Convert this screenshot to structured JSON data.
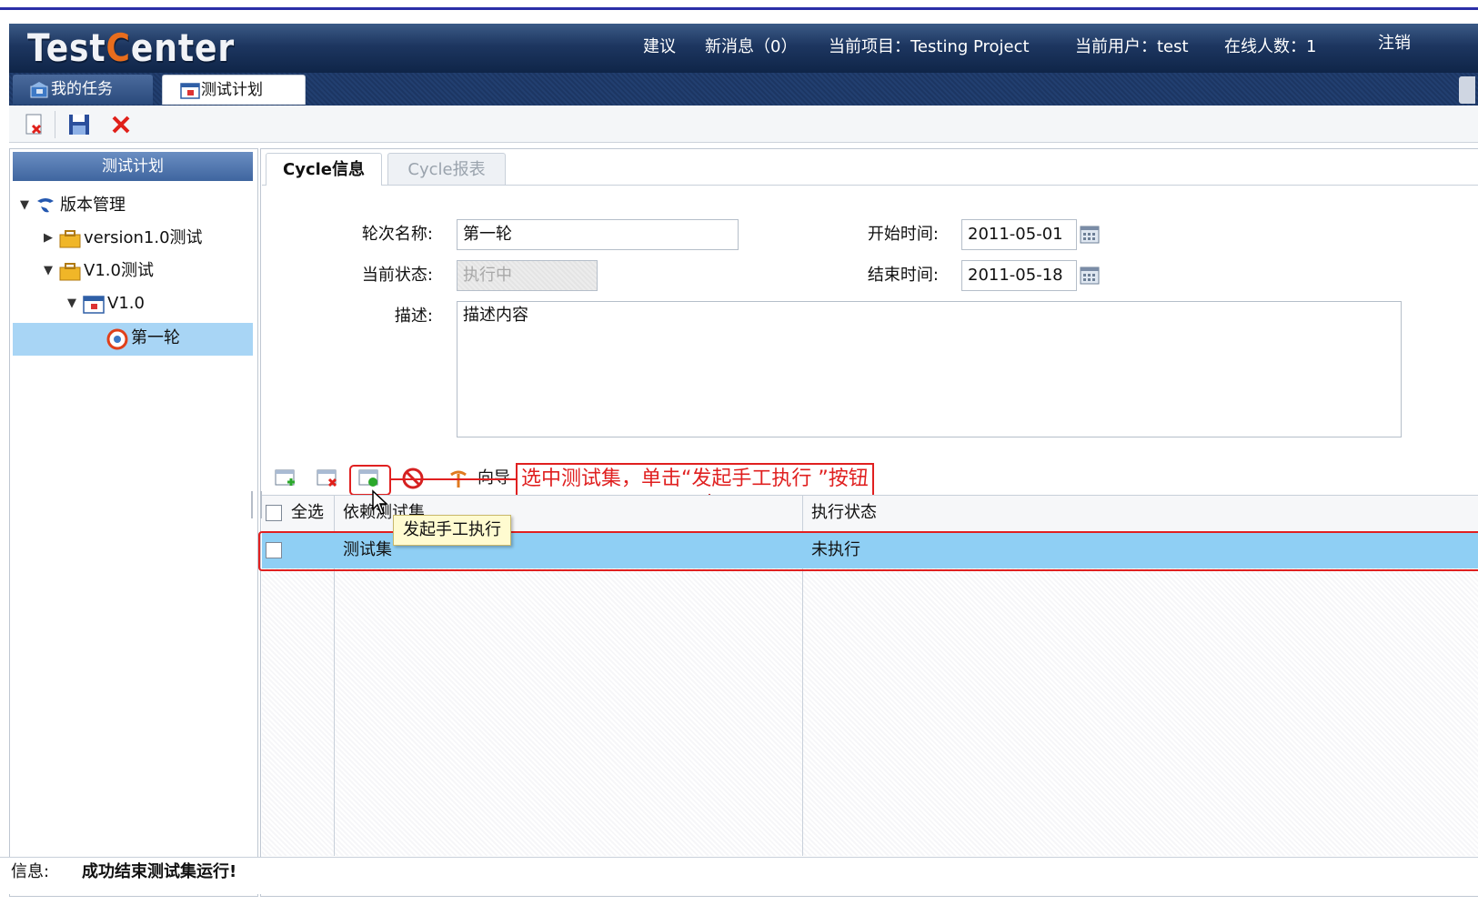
{
  "header": {
    "logo_prefix": "Test",
    "logo_c": "C",
    "logo_suffix": "enter",
    "suggestion": "建议",
    "messages": "新消息（0）",
    "current_project": "当前项目：Testing Project",
    "current_user": "当前用户：test",
    "online_count": "在线人数：1",
    "logout": "注销"
  },
  "tabs": [
    {
      "label": "我的任务",
      "icon": "tasks-icon"
    },
    {
      "label": "测试计划",
      "icon": "calendar-icon",
      "active": true
    }
  ],
  "toolbar": {
    "buttons": [
      "delete-doc-icon",
      "save-icon",
      "close-icon"
    ]
  },
  "left_panel": {
    "title": "测试计划",
    "tree": [
      {
        "label": "版本管理",
        "level": 0,
        "expanded": true,
        "icon": "version-logo-icon"
      },
      {
        "label": "version1.0测试",
        "level": 1,
        "expanded": false,
        "icon": "folder-icon"
      },
      {
        "label": "V1.0测试",
        "level": 1,
        "expanded": true,
        "icon": "folder-icon"
      },
      {
        "label": "V1.0",
        "level": 2,
        "expanded": true,
        "icon": "calendar-icon"
      },
      {
        "label": "第一轮",
        "level": 3,
        "selected": true,
        "icon": "cycle-icon"
      }
    ]
  },
  "inner_tabs": [
    {
      "label": "Cycle信息",
      "active": true
    },
    {
      "label": "Cycle报表",
      "active": false
    }
  ],
  "form": {
    "round_name_label": "轮次名称:",
    "round_name_value": "第一轮",
    "status_label": "当前状态:",
    "status_value": "执行中",
    "description_label": "描述:",
    "description_value": "描述内容",
    "start_label": "开始时间:",
    "start_value": "2011-05-01",
    "end_label": "结束时间:",
    "end_value": "2011-05-18"
  },
  "grid_toolbar": {
    "buttons": [
      "add-icon",
      "remove-icon",
      "start-manual-execution-icon",
      "stop-icon",
      "wizard-icon"
    ],
    "wizard_label": "向导",
    "tooltip": "发起手工执行"
  },
  "annotation": {
    "text": "选中测试集，单击“发起手工执行 ”按钮",
    "color": "#e02020"
  },
  "grid": {
    "columns": [
      "全选",
      "依赖测试集",
      "执行状态"
    ],
    "rows": [
      {
        "name": "测试集",
        "status": "未执行",
        "selected": true
      }
    ]
  },
  "status_bar": {
    "label": "信息:",
    "message": "成功结束测试集运行!"
  },
  "colors": {
    "header_bg": "#1d3660",
    "selected_row": "#8fcff4",
    "tree_selected": "#a8d5f5"
  }
}
